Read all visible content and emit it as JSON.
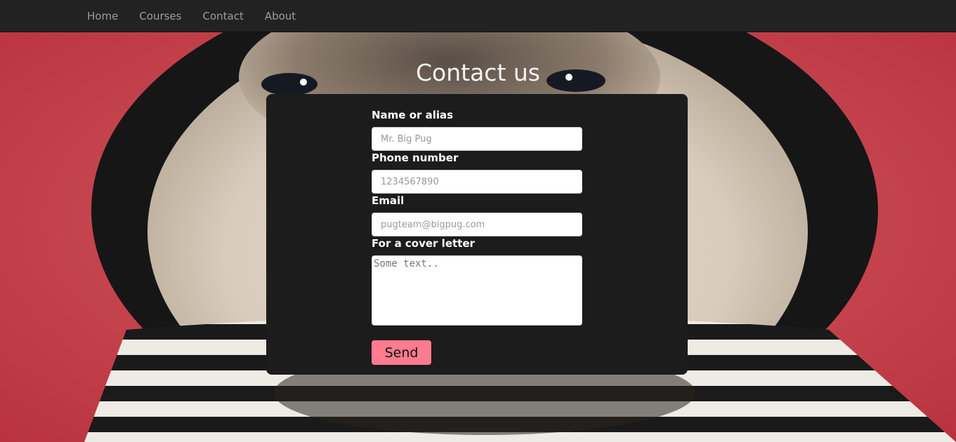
{
  "nav": {
    "items": [
      {
        "label": "Home"
      },
      {
        "label": "Courses"
      },
      {
        "label": "Contact"
      },
      {
        "label": "About"
      }
    ]
  },
  "page": {
    "title": "Contact us"
  },
  "form": {
    "name": {
      "label": "Name or alias",
      "placeholder": "Mr. Big Pug",
      "value": ""
    },
    "phone": {
      "label": "Phone number",
      "placeholder": "1234567890",
      "value": ""
    },
    "email": {
      "label": "Email",
      "placeholder": "pugteam@bigpug.com",
      "value": ""
    },
    "cover_letter": {
      "label": "For a cover letter",
      "placeholder": "Some text..",
      "value": ""
    },
    "submit_label": "Send"
  },
  "background": {
    "subject": "pug-in-hoodie-photo"
  },
  "colors": {
    "navbar": "#222222",
    "nav_text": "#9d9d9d",
    "panel": "#1c1c1c",
    "button": "#ff7b8f",
    "backdrop_red": "#c9434d"
  }
}
